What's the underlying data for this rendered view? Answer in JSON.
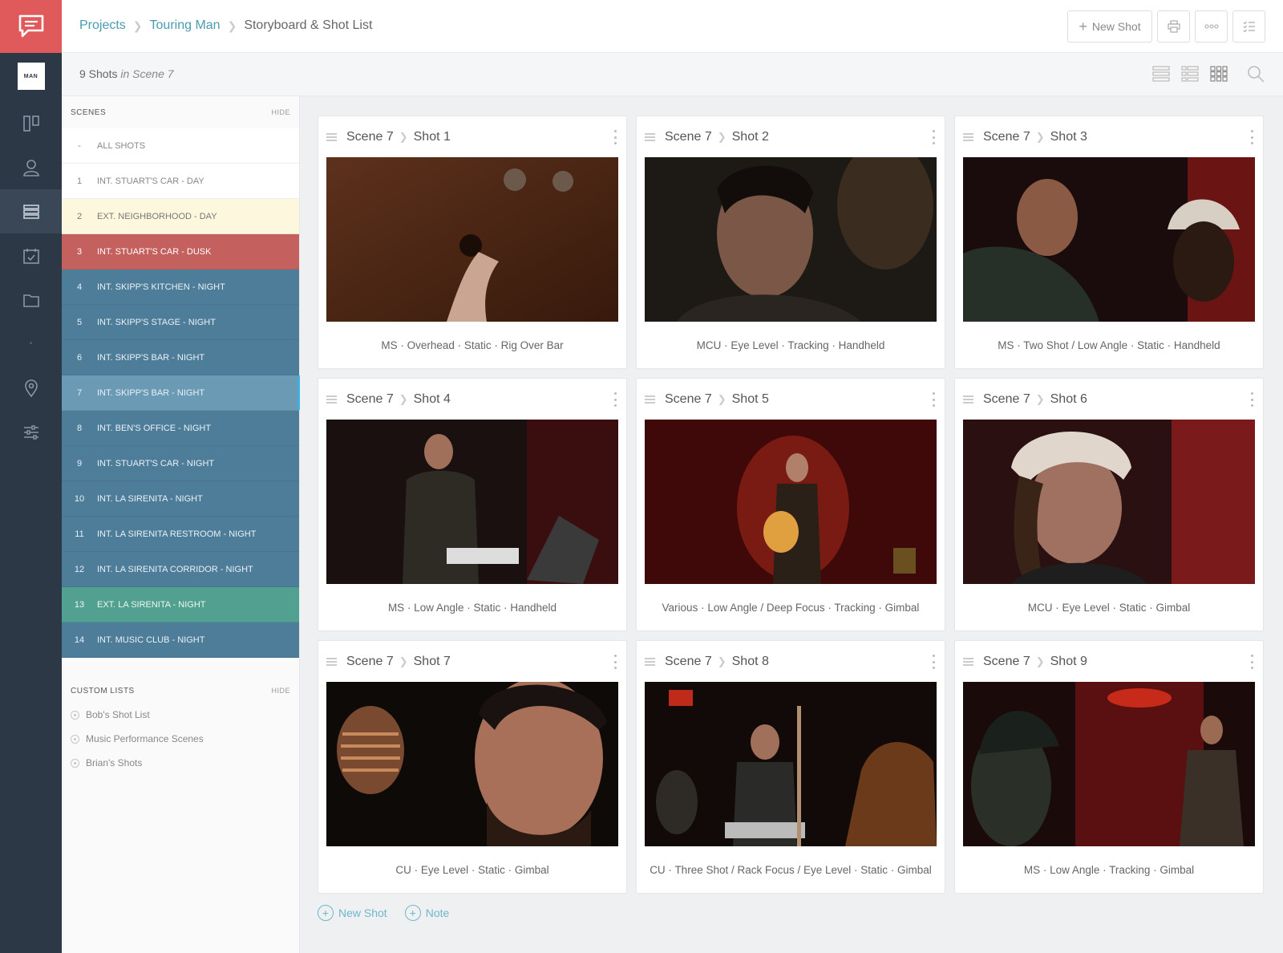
{
  "breadcrumb": {
    "projects": "Projects",
    "project": "Touring Man",
    "current": "Storyboard & Shot List"
  },
  "toolbar": {
    "new_shot": "New Shot"
  },
  "subbar": {
    "count": "9 Shots",
    "scope": "in Scene 7"
  },
  "rail": {
    "thumb_label": "MAN"
  },
  "scenes": {
    "header": "SCENES",
    "hide": "HIDE",
    "all": {
      "num": "-",
      "name": "ALL SHOTS"
    },
    "items": [
      {
        "num": "1",
        "name": "INT. STUART'S CAR - DAY",
        "color": "#ffffff"
      },
      {
        "num": "2",
        "name": "EXT. NEIGHBORHOOD - DAY",
        "color": "#fdf8dd"
      },
      {
        "num": "3",
        "name": "INT. STUART'S CAR - DUSK",
        "color": "#c4605e"
      },
      {
        "num": "4",
        "name": "INT. SKIPP'S KITCHEN - NIGHT",
        "color": "#4e7d9a"
      },
      {
        "num": "5",
        "name": "INT. SKIPP'S STAGE - NIGHT",
        "color": "#4e7d9a"
      },
      {
        "num": "6",
        "name": "INT. SKIPP'S BAR - NIGHT",
        "color": "#4e7d9a"
      },
      {
        "num": "7",
        "name": "INT. SKIPP'S BAR - NIGHT",
        "color": "#6b9ab5"
      },
      {
        "num": "8",
        "name": "INT. BEN'S OFFICE - NIGHT",
        "color": "#4e7d9a"
      },
      {
        "num": "9",
        "name": "INT. STUART'S CAR - NIGHT",
        "color": "#4e7d9a"
      },
      {
        "num": "10",
        "name": "INT. LA SIRENITA - NIGHT",
        "color": "#4e7d9a"
      },
      {
        "num": "11",
        "name": "INT. LA SIRENITA RESTROOM - NIGHT",
        "color": "#4e7d9a"
      },
      {
        "num": "12",
        "name": "INT. LA SIRENITA CORRIDOR - NIGHT",
        "color": "#4e7d9a"
      },
      {
        "num": "13",
        "name": "EXT. LA SIRENITA - NIGHT",
        "color": "#52a08f"
      },
      {
        "num": "14",
        "name": "INT. MUSIC CLUB - NIGHT",
        "color": "#4e7d9a"
      }
    ]
  },
  "custom_lists": {
    "header": "CUSTOM LISTS",
    "hide": "HIDE",
    "items": [
      "Bob's Shot List",
      "Music Performance Scenes",
      "Brian's Shots"
    ]
  },
  "shots": [
    {
      "scene": "Scene 7",
      "shot": "Shot 1",
      "meta": "MS · Overhead · Static · Rig Over Bar"
    },
    {
      "scene": "Scene 7",
      "shot": "Shot 2",
      "meta": "MCU · Eye Level · Tracking · Handheld"
    },
    {
      "scene": "Scene 7",
      "shot": "Shot 3",
      "meta": "MS · Two Shot / Low Angle · Static · Handheld"
    },
    {
      "scene": "Scene 7",
      "shot": "Shot 4",
      "meta": "MS · Low Angle · Static · Handheld"
    },
    {
      "scene": "Scene 7",
      "shot": "Shot 5",
      "meta": "Various · Low Angle / Deep Focus · Tracking · Gimbal"
    },
    {
      "scene": "Scene 7",
      "shot": "Shot 6",
      "meta": "MCU · Eye Level · Static · Gimbal"
    },
    {
      "scene": "Scene 7",
      "shot": "Shot 7",
      "meta": "CU · Eye Level · Static · Gimbal"
    },
    {
      "scene": "Scene 7",
      "shot": "Shot 8",
      "meta": "CU · Three Shot / Rack Focus / Eye Level · Static · Gimbal"
    },
    {
      "scene": "Scene 7",
      "shot": "Shot 9",
      "meta": "MS · Low Angle · Tracking · Gimbal"
    }
  ],
  "bottom": {
    "new_shot": "New Shot",
    "note": "Note"
  },
  "colors": {
    "accent": "#4a9bb0",
    "brand": "#e05a5c",
    "rail": "#2c3846"
  }
}
